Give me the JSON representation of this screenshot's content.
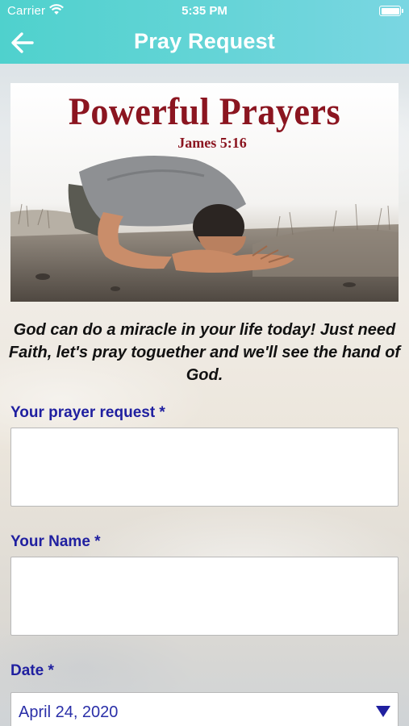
{
  "status_bar": {
    "carrier": "Carrier",
    "time": "5:35 PM",
    "icons": [
      "wifi-icon",
      "battery-icon"
    ]
  },
  "nav": {
    "title": "Pray Request",
    "back_icon": "arrow-left-icon"
  },
  "banner": {
    "title": "Powerful Prayers",
    "subtitle": "James 5:16"
  },
  "intro_text": "God can do a miracle in your life today! Just need Faith, let's pray toguether and we'll see the hand of God.",
  "form": {
    "prayer_request": {
      "label": "Your prayer request *",
      "value": ""
    },
    "name": {
      "label": "Your Name *",
      "value": ""
    },
    "date": {
      "label": "Date *",
      "value": "April 24, 2020",
      "caret_icon": "caret-down-icon"
    }
  },
  "colors": {
    "nav_bar": "#5fd3d2",
    "banner_title": "#8b1520",
    "label": "#2020a0",
    "date_text": "#2a2fa8"
  }
}
